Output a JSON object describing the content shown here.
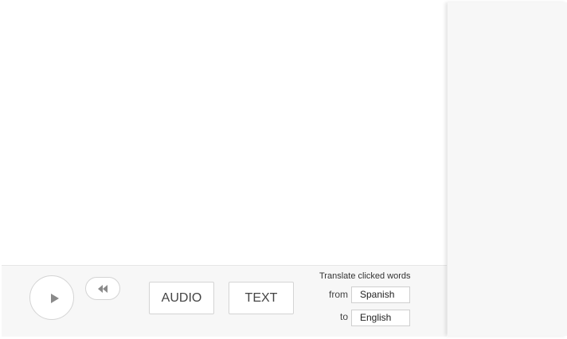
{
  "controls": {
    "play_icon": "play-icon",
    "rewind_icon": "rewind-icon",
    "audio_label": "AUDIO",
    "text_label": "TEXT"
  },
  "translate": {
    "title": "Translate clicked words",
    "from_label": "from",
    "from_value": "Spanish",
    "to_label": "to",
    "to_value": "English"
  },
  "colors": {
    "bar_background": "#f7f7f7",
    "border": "#d4d4d4",
    "icon": "#888888"
  }
}
